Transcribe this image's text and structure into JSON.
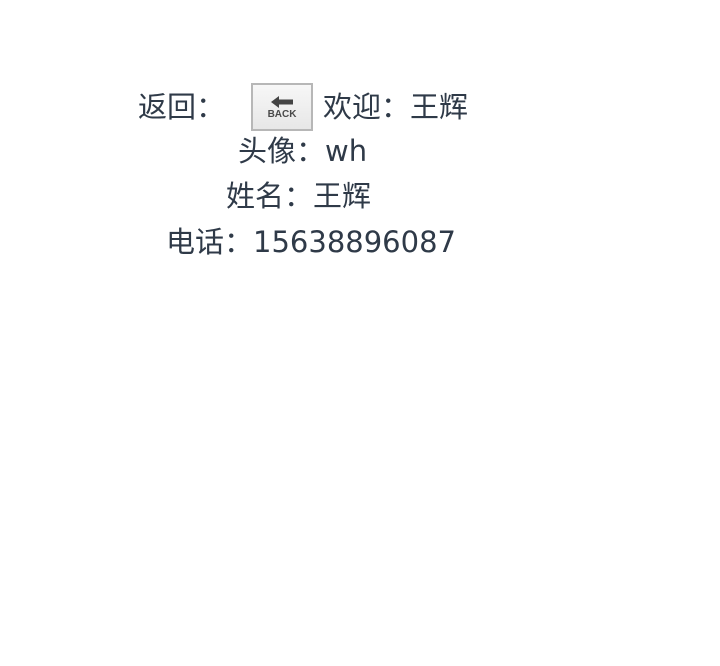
{
  "header": {
    "back_label": "返回：",
    "back_button_text": "BACK",
    "welcome_label": "欢迎：",
    "welcome_name": "王辉"
  },
  "profile": {
    "avatar_label": "头像：",
    "avatar_value": "wh",
    "name_label": "姓名：",
    "name_value": "王辉",
    "phone_label": "电话：",
    "phone_value": "15638896087"
  },
  "icons": {
    "back_icon": "arrow-left-icon"
  },
  "colors": {
    "text": "#2f3a48",
    "button_bg": "#efefef",
    "button_border": "#b7b7b7"
  }
}
